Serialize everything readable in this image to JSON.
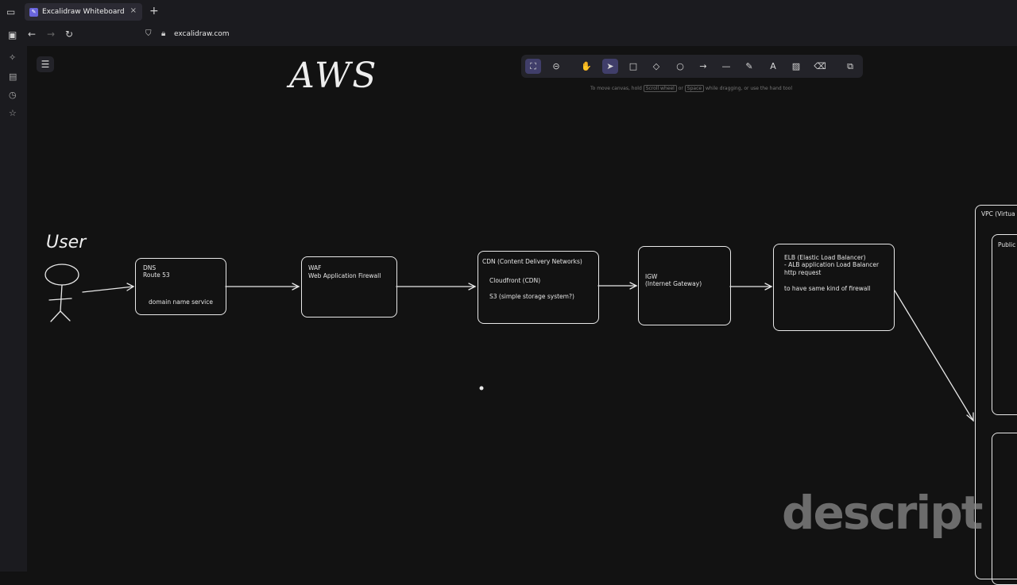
{
  "browser": {
    "tab_title": "Excalidraw Whiteboard",
    "tab_close": "×",
    "new_tab": "+",
    "url": "excalidraw.com"
  },
  "canvas": {
    "title": "AWS",
    "user_label": "User",
    "hint_prefix": "To move canvas, hold",
    "hint_key1": "Scroll wheel",
    "hint_mid": "or",
    "hint_key2": "Space",
    "hint_suffix": "while dragging, or use the hand tool",
    "boxes": {
      "dns": {
        "line1": "DNS",
        "line2": "Route 53",
        "line3": "domain name service"
      },
      "waf": {
        "line1": "WAF",
        "line2": "Web Application Firewall"
      },
      "cdn": {
        "line1": "CDN (Content Delivery Networks)",
        "line2": "Cloudfront (CDN)",
        "line3": "S3 (simple storage system?)"
      },
      "igw": {
        "line1": "IGW",
        "line2": "(Internet Gateway)"
      },
      "elb": {
        "line1": "ELB (Elastic Load Balancer)",
        "line2": "- ALB application Load Balancer",
        "line3": "http request",
        "line4": "to have same kind of firewall"
      },
      "vpc": {
        "line1": "VPC (Virtua"
      },
      "public": {
        "line1": "Public"
      }
    },
    "watermark": "descript"
  }
}
